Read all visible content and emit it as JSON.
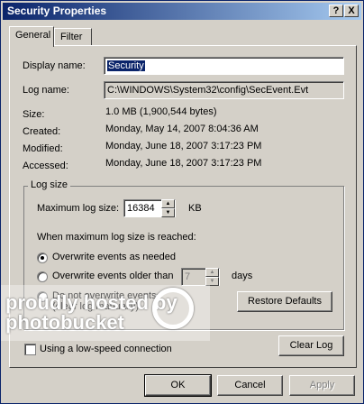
{
  "window": {
    "title": "Security Properties",
    "help_btn": "?",
    "close_btn": "X"
  },
  "tabs": [
    {
      "label": "General",
      "active": true
    },
    {
      "label": "Filter",
      "active": false
    }
  ],
  "general": {
    "display_name_label": "Display name:",
    "display_name_value": "Security",
    "log_name_label": "Log name:",
    "log_name_value": "C:\\WINDOWS\\System32\\config\\SecEvent.Evt",
    "size_label": "Size:",
    "size_value": "1.0 MB (1,900,544 bytes)",
    "created_label": "Created:",
    "created_value": "Monday, May 14, 2007 8:04:36 AM",
    "modified_label": "Modified:",
    "modified_value": "Monday, June 18, 2007 3:17:23 PM",
    "accessed_label": "Accessed:",
    "accessed_value": "Monday, June 18, 2007 3:17:23 PM"
  },
  "log_size": {
    "group_label": "Log size",
    "max_size_label": "Maximum log size:",
    "max_size_value": "16384",
    "max_size_unit": "KB",
    "when_reached_label": "When maximum log size is reached:",
    "opt_overwrite_needed": "Overwrite events as needed",
    "opt_overwrite_older": "Overwrite events older than",
    "older_days_value": "7",
    "days_label": "days",
    "opt_do_not_overwrite": "Do not overwrite events",
    "opt_do_not_overwrite_sub": "(clear log manually)",
    "selected_option": "overwrite_needed",
    "restore_defaults": "Restore Defaults"
  },
  "bottom": {
    "low_speed_label": "Using a low-speed connection",
    "clear_log": "Clear Log"
  },
  "dialog_buttons": {
    "ok": "OK",
    "cancel": "Cancel",
    "apply": "Apply"
  },
  "watermark": {
    "line1": "proudly hosted by",
    "line2": "photobucket"
  }
}
